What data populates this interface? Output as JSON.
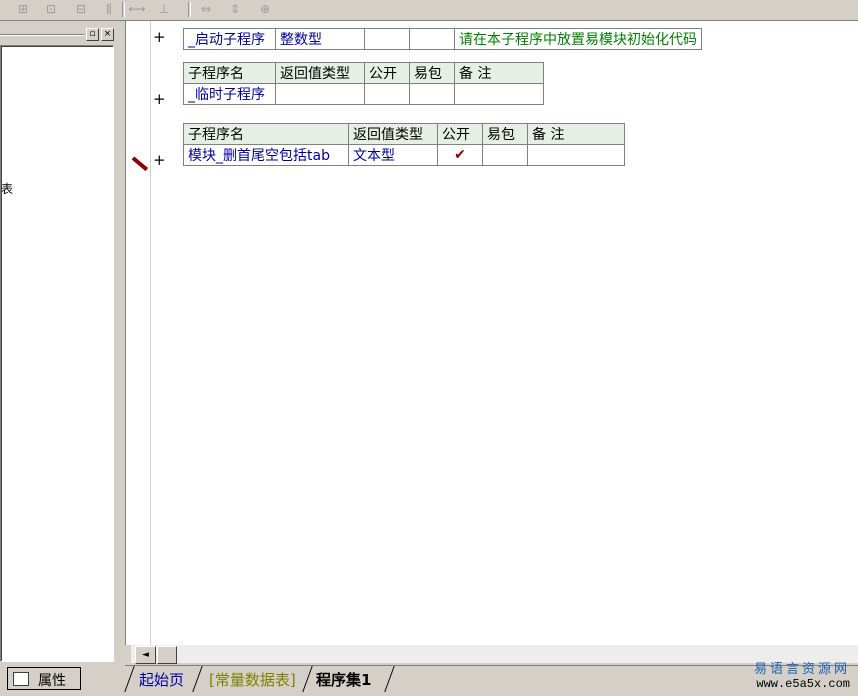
{
  "toolbar": {
    "icons": [
      "table-merge-icon",
      "table-insert-icon",
      "table-split-icon",
      "table-col-icon",
      "align-h-icon",
      "align-v-icon",
      "fit-width-icon",
      "fit-height-icon",
      "fit-both-icon"
    ]
  },
  "left_panel": {
    "minimize_glyph": "▫",
    "close_glyph": "×",
    "tree_partial_text": "表",
    "property_tab_label": "属性"
  },
  "editor": {
    "row1": {
      "name": "_启动子程序",
      "return_type": "整数型",
      "public": "",
      "easy_pkg": "",
      "note": "请在本子程序中放置易模块初始化代码"
    },
    "headers": {
      "name": "子程序名",
      "return_type": "返回值类型",
      "public": "公开",
      "easy_pkg": "易包",
      "note": "备 注"
    },
    "row2": {
      "name": "_临时子程序",
      "return_type": "",
      "public": "",
      "easy_pkg": "",
      "note": ""
    },
    "row3": {
      "name": "模块_删首尾空包括tab",
      "return_type": "文本型",
      "public": "✔",
      "easy_pkg": "",
      "note": ""
    },
    "plus_glyph": "+"
  },
  "scroll": {
    "left_arrow": "◄"
  },
  "tabs": {
    "start": "起始页",
    "const": "[常量数据表]",
    "prog": "程序集1"
  },
  "watermark": {
    "line1": "易语言资源网",
    "line2": "www.e5a5x.com"
  },
  "colors": {
    "header_bg": "#e6efe6",
    "type_text": "#0000a0",
    "note_text": "#008000",
    "check": "#8b0000"
  }
}
